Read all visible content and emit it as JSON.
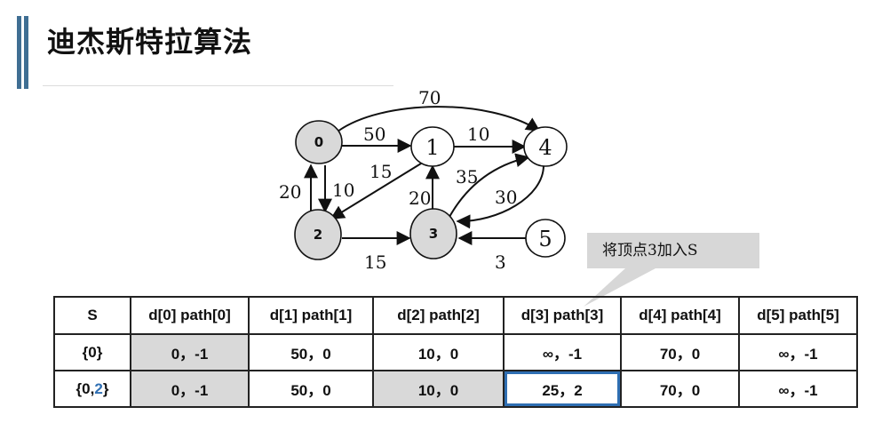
{
  "title": "迪杰斯特拉算法",
  "graph": {
    "nodes": [
      {
        "id": "0",
        "label": "0",
        "filled": true
      },
      {
        "id": "1",
        "label": "1",
        "filled": false
      },
      {
        "id": "2",
        "label": "2",
        "filled": true
      },
      {
        "id": "3",
        "label": "3",
        "filled": true
      },
      {
        "id": "4",
        "label": "4",
        "filled": false
      },
      {
        "id": "5",
        "label": "5",
        "filled": false
      }
    ],
    "edges": [
      {
        "from": "0",
        "to": "1",
        "weight": "50"
      },
      {
        "from": "0",
        "to": "4",
        "weight": "70"
      },
      {
        "from": "0",
        "to": "2",
        "weight": "10"
      },
      {
        "from": "2",
        "to": "0",
        "weight": "20"
      },
      {
        "from": "1",
        "to": "4",
        "weight": "10"
      },
      {
        "from": "1",
        "to": "2",
        "weight": "15"
      },
      {
        "from": "3",
        "to": "1",
        "weight": "20"
      },
      {
        "from": "3",
        "to": "4",
        "weight": "35"
      },
      {
        "from": "4",
        "to": "3",
        "weight": "30"
      },
      {
        "from": "2",
        "to": "3",
        "weight": "15"
      },
      {
        "from": "5",
        "to": "3",
        "weight": "3"
      }
    ]
  },
  "callout": "将顶点3加入S",
  "table": {
    "headers": [
      "S",
      "d[0] path[0]",
      "d[1] path[1]",
      "d[2] path[2]",
      "d[3] path[3]",
      "d[4] path[4]",
      "d[5] path[5]"
    ],
    "rows": [
      {
        "s_open": "{0}",
        "s_new": "",
        "s_close": "",
        "cells": [
          "0，-1",
          "50，0",
          "10，0",
          "∞，-1",
          "70，0",
          "∞，-1"
        ]
      },
      {
        "s_open": "{0,",
        "s_new": "2",
        "s_close": "}",
        "cells": [
          "0，-1",
          "50，0",
          "10，0",
          "25，2",
          "70，0",
          "∞，-1"
        ]
      }
    ]
  },
  "colors": {
    "accent": "#3f6e93",
    "filled_node": "#d9d9d9",
    "highlight": "#2f6fb3",
    "new_vertex": "#2f6fb3"
  }
}
